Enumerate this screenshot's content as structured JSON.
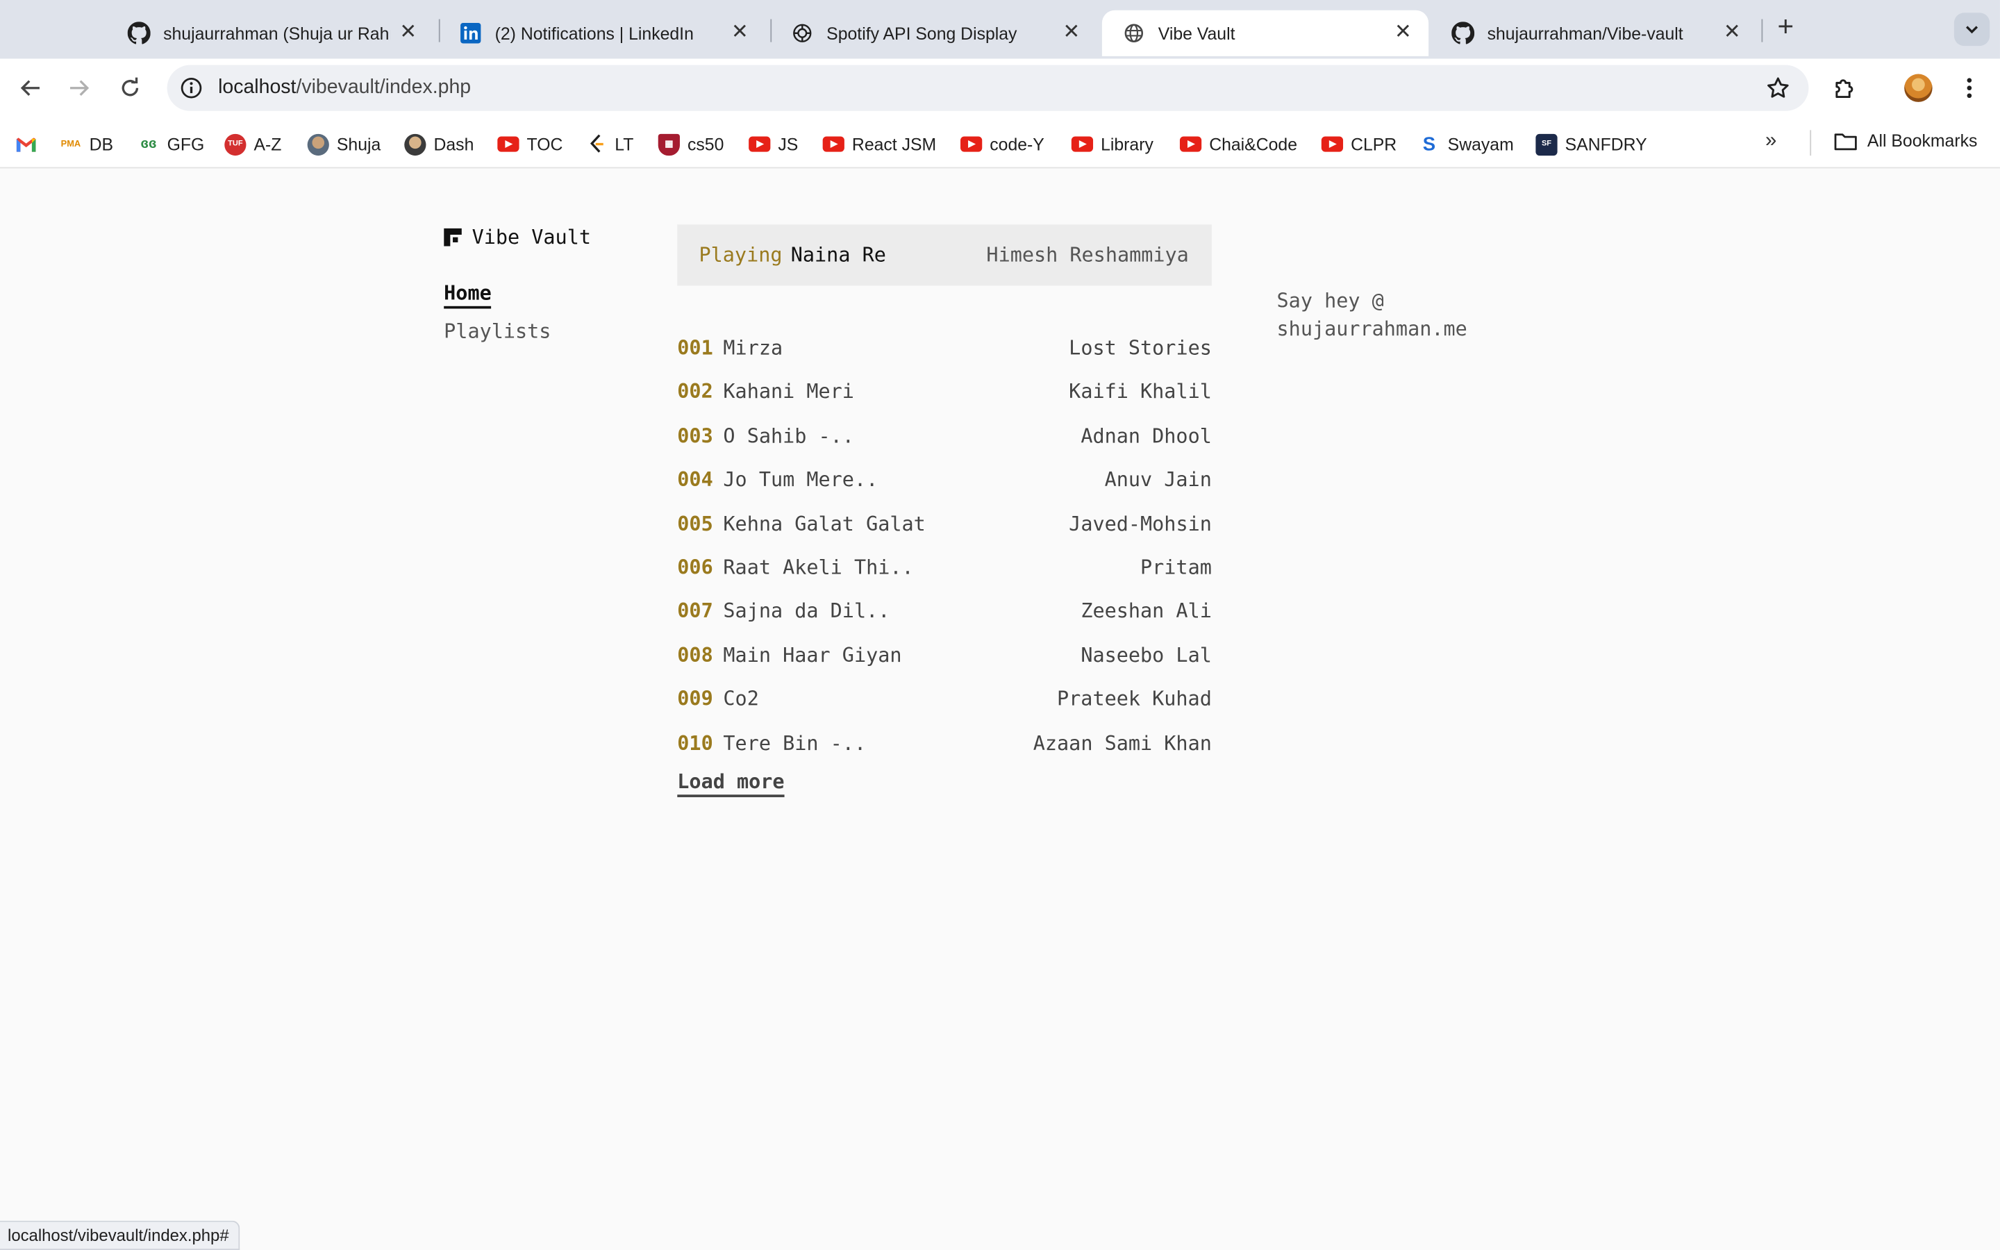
{
  "browser": {
    "tabs": [
      {
        "title": "shujaurrahman (Shuja ur Rahman)",
        "icon": "github-icon"
      },
      {
        "title": "(2) Notifications | LinkedIn",
        "icon": "linkedin-icon"
      },
      {
        "title": "Spotify API Song Display",
        "icon": "openai-icon"
      },
      {
        "title": "Vibe Vault",
        "icon": "globe-icon"
      },
      {
        "title": "shujaurrahman/Vibe-vault",
        "icon": "github-icon"
      }
    ],
    "active_tab": 3,
    "url_host": "localhost",
    "url_path": "/vibevault/index.php",
    "bookmarks": [
      {
        "label": "",
        "icon": "gmail-icon"
      },
      {
        "label": "DB",
        "icon": "pma-icon"
      },
      {
        "label": "GFG",
        "icon": "gfg-icon"
      },
      {
        "label": "A-Z",
        "icon": "tuf-icon"
      },
      {
        "label": "Shuja",
        "icon": "avatar-icon"
      },
      {
        "label": "Dash",
        "icon": "avatar-icon"
      },
      {
        "label": "TOC",
        "icon": "youtube-icon"
      },
      {
        "label": "LT",
        "icon": "leetcode-icon"
      },
      {
        "label": "cs50",
        "icon": "harvard-icon"
      },
      {
        "label": "JS",
        "icon": "youtube-icon"
      },
      {
        "label": "React JSM",
        "icon": "youtube-icon"
      },
      {
        "label": "code-Y",
        "icon": "youtube-icon"
      },
      {
        "label": "Library",
        "icon": "youtube-icon"
      },
      {
        "label": "Chai&Code",
        "icon": "youtube-icon"
      },
      {
        "label": "CLPR",
        "icon": "youtube-icon"
      },
      {
        "label": "Swayam",
        "icon": "swayam-icon"
      },
      {
        "label": "SANFDRY",
        "icon": "sanfdry-icon"
      }
    ],
    "all_bookmarks": "All Bookmarks",
    "status_url": "localhost/vibevault/index.php#"
  },
  "app": {
    "brand": "Vibe Vault",
    "nav": {
      "home": "Home",
      "playlists": "Playlists"
    },
    "now_playing": {
      "label": "Playing",
      "song": "Naina Re",
      "artist": "Himesh Reshammiya"
    },
    "tracks": [
      {
        "num": "001",
        "title": "Mirza",
        "artist": "Lost Stories"
      },
      {
        "num": "002",
        "title": "Kahani Meri",
        "artist": "Kaifi Khalil"
      },
      {
        "num": "003",
        "title": "O Sahib -..",
        "artist": "Adnan Dhool"
      },
      {
        "num": "004",
        "title": "Jo Tum Mere..",
        "artist": "Anuv Jain"
      },
      {
        "num": "005",
        "title": "Kehna Galat Galat",
        "artist": "Javed-Mohsin"
      },
      {
        "num": "006",
        "title": "Raat Akeli Thi..",
        "artist": "Pritam"
      },
      {
        "num": "007",
        "title": "Sajna da Dil..",
        "artist": "Zeeshan Ali"
      },
      {
        "num": "008",
        "title": "Main Haar Giyan",
        "artist": "Naseebo Lal"
      },
      {
        "num": "009",
        "title": "Co2",
        "artist": "Prateek Kuhad"
      },
      {
        "num": "010",
        "title": "Tere Bin -..",
        "artist": "Azaan Sami Khan"
      }
    ],
    "load_more": "Load more",
    "contact_line1": "Say hey @",
    "contact_line2": "shujaurrahman.me"
  },
  "colors": {
    "accent": "#9a7a1e",
    "text": "#444444",
    "page_bg": "#fafafa"
  }
}
